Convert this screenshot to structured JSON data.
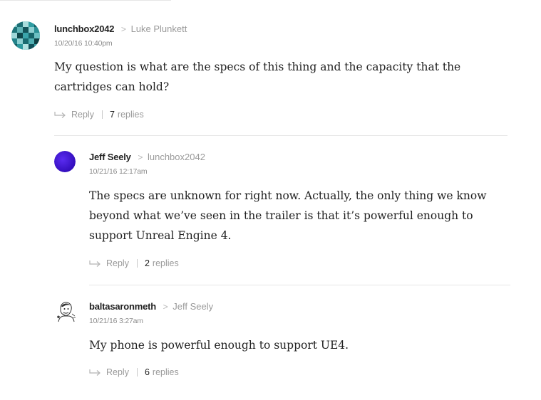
{
  "comments": [
    {
      "author": "lunchbox2042",
      "reply_to": "Luke Plunkett",
      "timestamp": "10/20/16 10:40pm",
      "body": "My question is what are the specs of this thing and the capacity that the cartridges can hold?",
      "reply_label": "Reply",
      "replies_count": "7",
      "replies_word": "replies",
      "avatar_icon": "teal-pixel-avatar"
    },
    {
      "author": "Jeff Seely",
      "reply_to": "lunchbox2042",
      "timestamp": "10/21/16 12:17am",
      "body": "The specs are unknown for right now. Actually, the only thing we know beyond what we’ve seen in the trailer is that it’s powerful enough to support Unreal Engine 4.",
      "reply_label": "Reply",
      "replies_count": "2",
      "replies_word": "replies",
      "avatar_icon": "purple-circle-avatar"
    },
    {
      "author": "baltasaronmeth",
      "reply_to": "Jeff Seely",
      "timestamp": "10/21/16 3:27am",
      "body": "My phone is powerful enough to support UE4.",
      "reply_label": "Reply",
      "replies_count": "6",
      "replies_word": "replies",
      "avatar_icon": "sketch-portrait-avatar"
    }
  ],
  "colors": {
    "author": "#222222",
    "secondary": "#9a9a9a",
    "divider": "#e6e6e6",
    "teal_avatar": "#2a8f95",
    "purple_avatar": "#3a0fd0"
  }
}
